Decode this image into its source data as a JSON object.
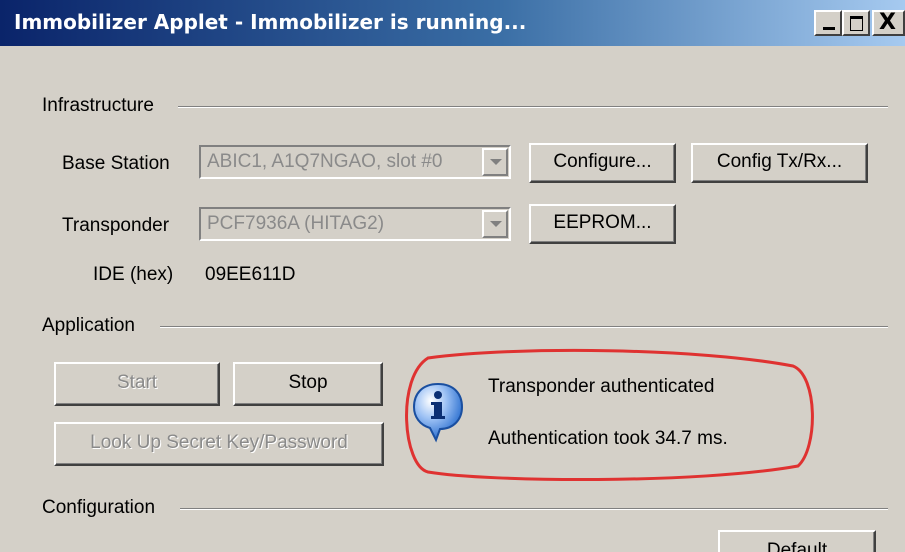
{
  "window": {
    "title": "Immobilizer Applet - Immobilizer is running...",
    "controls": {
      "minimize": "_",
      "maximize": "□",
      "close": "X"
    }
  },
  "infrastructure": {
    "group_label": "Infrastructure",
    "base_station": {
      "label": "Base Station",
      "value": "ABIC1, A1Q7NGAO, slot #0",
      "configure_button": "Configure...",
      "config_txrx_button": "Config Tx/Rx..."
    },
    "transponder": {
      "label": "Transponder",
      "value": "PCF7936A (HITAG2)",
      "eeprom_button": "EEPROM..."
    },
    "ide": {
      "label": "IDE (hex)",
      "value": "09EE611D"
    }
  },
  "application": {
    "group_label": "Application",
    "start_button": "Start",
    "stop_button": "Stop",
    "lookup_button": "Look Up Secret Key/Password",
    "message": {
      "line1": "Transponder authenticated",
      "line2": "Authentication took 34.7 ms."
    }
  },
  "configuration": {
    "group_label": "Configuration",
    "default_button": "Default"
  },
  "colors": {
    "window_bg": "#d4d0c8",
    "titlebar_start": "#0a246a",
    "titlebar_end": "#a6caf0",
    "annotation_red": "#e02020",
    "info_icon_blue": "#1a5fc8"
  },
  "icons": {
    "info": "info-icon"
  }
}
